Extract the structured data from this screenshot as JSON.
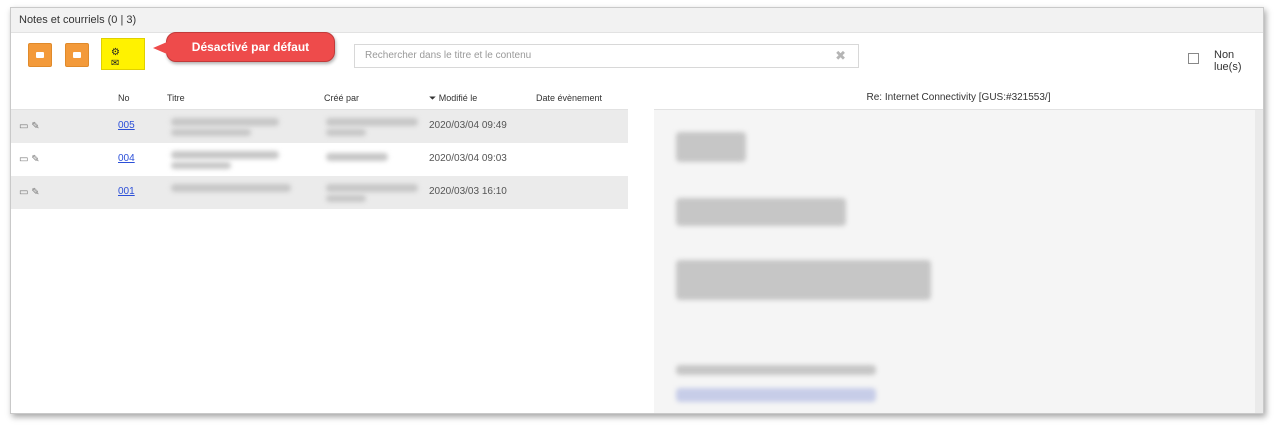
{
  "window": {
    "title": "Notes et courriels (0 | 3)"
  },
  "toolbar": {
    "highlight_button_label": "⚙ ✉",
    "callout_text": "Désactivé par défaut"
  },
  "search": {
    "placeholder": "Rechercher dans le titre et le contenu",
    "clear_icon": "✖"
  },
  "filter": {
    "unread_label": "Non lue(s)"
  },
  "table": {
    "headers": [
      "No",
      "Titre",
      "Créé par",
      "⏷ Modifié le",
      "Date évènement"
    ],
    "rows": [
      {
        "icons": "▭ ✎",
        "no": "005",
        "date": "2020/03/04 09:49"
      },
      {
        "icons": "▭ ✎",
        "no": "004",
        "date": "2020/03/04 09:03"
      },
      {
        "icons": "▭ ✎",
        "no": "001",
        "date": "2020/03/03 16:10"
      }
    ]
  },
  "preview": {
    "title": "Re: Internet Connectivity [GUS:#321553/]"
  },
  "colors": {
    "orange": "#f39a3a",
    "highlight": "#fff200",
    "callout": "#ee4b4b",
    "link": "#2b4fd8"
  }
}
